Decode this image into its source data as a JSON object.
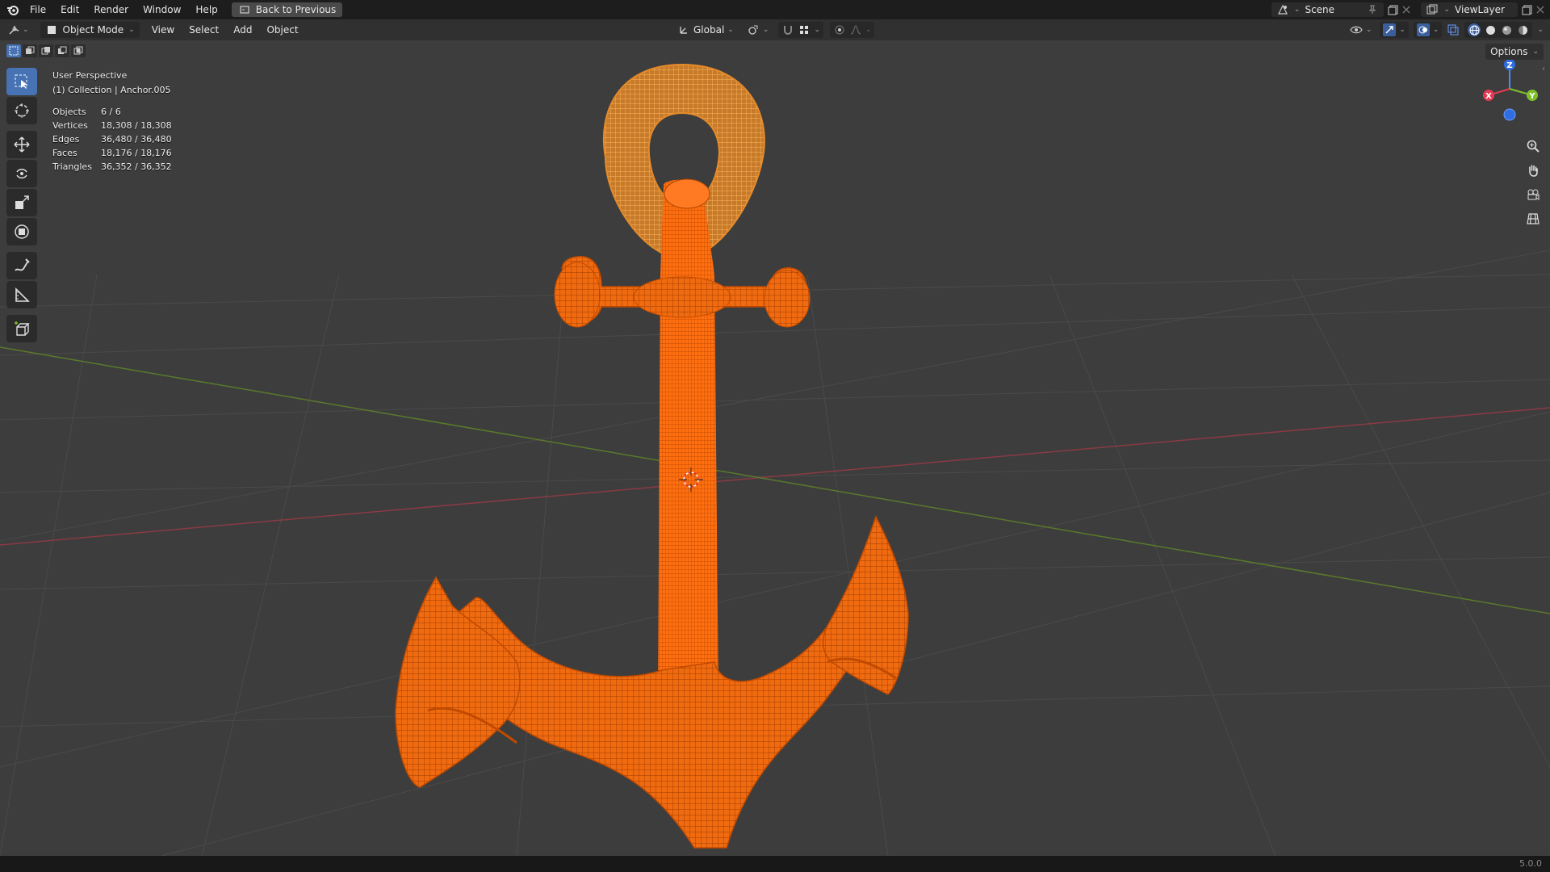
{
  "menubar": {
    "items": [
      "File",
      "Edit",
      "Render",
      "Window",
      "Help"
    ],
    "back_button": "Back to Previous",
    "scene": "Scene",
    "view_layer": "ViewLayer"
  },
  "header": {
    "mode": "Object Mode",
    "menus": [
      "View",
      "Select",
      "Add",
      "Object"
    ],
    "orientation": "Global",
    "options": "Options"
  },
  "overlay": {
    "perspective": "User Perspective",
    "collection": "(1) Collection | Anchor.005"
  },
  "stats": [
    {
      "label": "Objects",
      "value": "6 / 6"
    },
    {
      "label": "Vertices",
      "value": "18,308 / 18,308"
    },
    {
      "label": "Edges",
      "value": "36,480 / 36,480"
    },
    {
      "label": "Faces",
      "value": "18,176 / 18,176"
    },
    {
      "label": "Triangles",
      "value": "36,352 / 36,352"
    }
  ],
  "gizmo": {
    "x": "X",
    "y": "Y",
    "z": "Z"
  },
  "status": {
    "version": "5.0.0"
  },
  "colors": {
    "selection": "#ff6a00",
    "accent": "#4772b3",
    "active_ring": "#ffb040"
  }
}
